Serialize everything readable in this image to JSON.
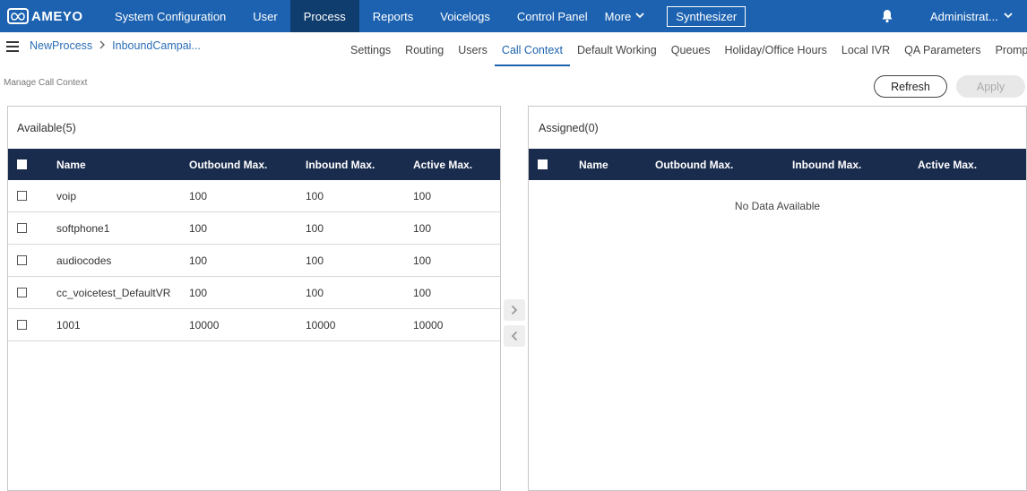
{
  "app": {
    "logo_text": "AMEYO"
  },
  "nav": {
    "items": [
      "System Configuration",
      "User",
      "Process",
      "Reports",
      "Voicelogs",
      "Control Panel"
    ],
    "more_label": "More",
    "synth_label": "Synthesizer",
    "admin_label": "Administrat..."
  },
  "breadcrumb": {
    "root": "NewProcess",
    "current": "InboundCampai..."
  },
  "tabs": [
    "Settings",
    "Routing",
    "Users",
    "Call Context",
    "Default Working",
    "Queues",
    "Holiday/Office Hours",
    "Local IVR",
    "QA Parameters",
    "Prompt"
  ],
  "section_title": "Manage Call Context",
  "buttons": {
    "refresh": "Refresh",
    "apply": "Apply"
  },
  "available": {
    "title": "Available(5)",
    "headers": [
      "Name",
      "Outbound Max.",
      "Inbound Max.",
      "Active Max."
    ],
    "rows": [
      [
        "voip",
        "100",
        "100",
        "100"
      ],
      [
        "softphone1",
        "100",
        "100",
        "100"
      ],
      [
        "audiocodes",
        "100",
        "100",
        "100"
      ],
      [
        "cc_voicetest_DefaultVR",
        "100",
        "100",
        "100"
      ],
      [
        "1001",
        "10000",
        "10000",
        "10000"
      ]
    ]
  },
  "assigned": {
    "title": "Assigned(0)",
    "headers": [
      "Name",
      "Outbound Max.",
      "Inbound Max.",
      "Active Max."
    ],
    "empty_text": "No Data Available"
  }
}
